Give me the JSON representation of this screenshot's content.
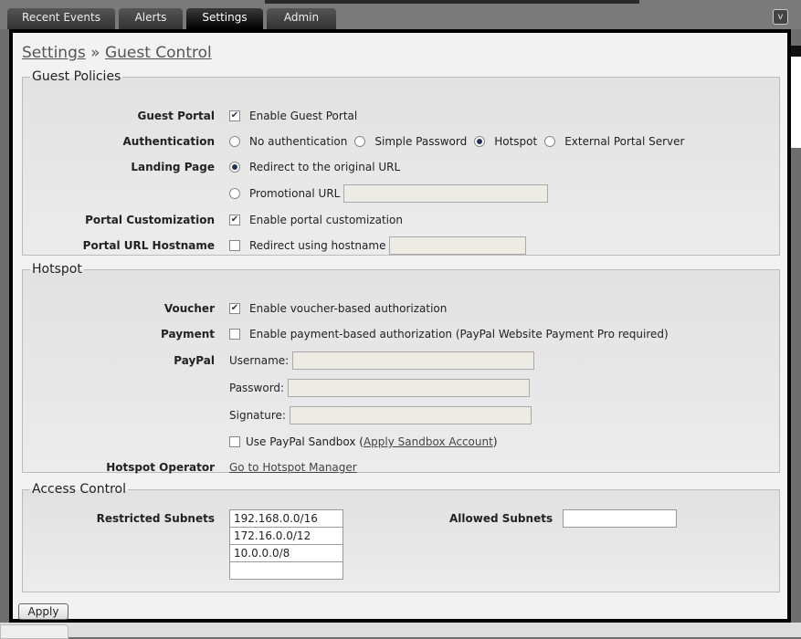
{
  "tabs": [
    {
      "label": "Recent Events"
    },
    {
      "label": "Alerts"
    },
    {
      "label": "Settings"
    },
    {
      "label": "Admin"
    }
  ],
  "collapse_glyph": "v",
  "breadcrumb": {
    "parent": "Settings",
    "sep": "»",
    "current": "Guest Control"
  },
  "guest_policies": {
    "legend": "Guest Policies",
    "guest_portal": {
      "label": "Guest Portal",
      "option": "Enable Guest Portal",
      "checked": true
    },
    "authentication": {
      "label": "Authentication",
      "options": [
        "No authentication",
        "Simple Password",
        "Hotspot",
        "External Portal Server"
      ],
      "selected": "Hotspot"
    },
    "landing_page": {
      "label": "Landing Page",
      "options": [
        "Redirect to the original URL",
        "Promotional URL"
      ],
      "selected": "Redirect to the original URL",
      "promo_url": ""
    },
    "portal_customization": {
      "label": "Portal Customization",
      "option": "Enable portal customization",
      "checked": true
    },
    "portal_url_hostname": {
      "label": "Portal URL Hostname",
      "option": "Redirect using hostname",
      "checked": false,
      "value": ""
    }
  },
  "hotspot": {
    "legend": "Hotspot",
    "voucher": {
      "label": "Voucher",
      "option": "Enable voucher-based authorization",
      "checked": true
    },
    "payment": {
      "label": "Payment",
      "option": "Enable payment-based authorization (PayPal Website Payment Pro required)",
      "checked": false
    },
    "paypal": {
      "label": "PayPal",
      "username_label": "Username:",
      "password_label": "Password:",
      "signature_label": "Signature:",
      "sandbox_label": "Use PayPal Sandbox (",
      "sandbox_link": "Apply Sandbox Account",
      "sandbox_close": ")",
      "sandbox_checked": false
    },
    "operator": {
      "label": "Hotspot Operator",
      "link": "Go to Hotspot Manager"
    }
  },
  "access_control": {
    "legend": "Access Control",
    "restricted_label": "Restricted Subnets",
    "restricted": [
      "192.168.0.0/16",
      "172.16.0.0/12",
      "10.0.0.0/8",
      ""
    ],
    "allowed_label": "Allowed Subnets",
    "allowed": [
      ""
    ]
  },
  "apply_label": "Apply"
}
